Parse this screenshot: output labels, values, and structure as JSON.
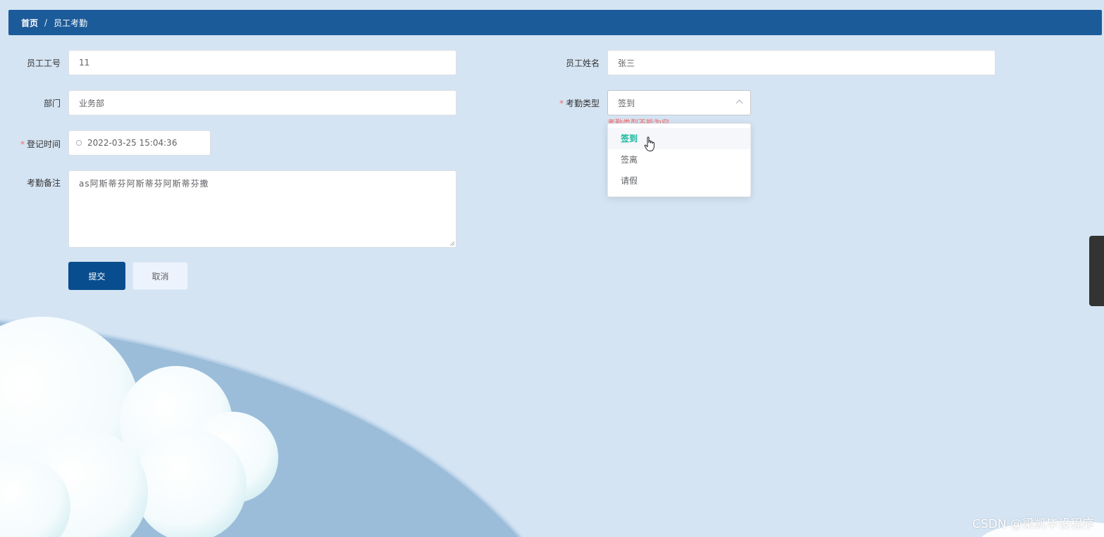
{
  "breadcrumb": {
    "home": "首页",
    "separator": "/",
    "current": "员工考勤"
  },
  "form": {
    "employee_id": {
      "label": "员工工号",
      "value": "11"
    },
    "employee_name": {
      "label": "员工姓名",
      "value": "张三"
    },
    "department": {
      "label": "部门",
      "value": "业务部"
    },
    "attendance_type": {
      "label": "考勤类型",
      "required_mark": "*",
      "value": "签到",
      "error": "考勤类型不能为空",
      "options": [
        "签到",
        "签离",
        "请假"
      ],
      "selected_option": "签到"
    },
    "register_time": {
      "label": "登记时间",
      "required_mark": "*",
      "value": "2022-03-25 15:04:36"
    },
    "remark": {
      "label": "考勤备注",
      "value": "as阿斯蒂芬阿斯蒂芬阿斯蒂芬撒"
    }
  },
  "buttons": {
    "submit": "提交",
    "cancel": "取消"
  },
  "watermark": "CSDN @梁凯毕设程序",
  "colors": {
    "header": "#1c5b9a",
    "primary_button": "#084d8e",
    "selected_option": "#15b69b",
    "error": "#f56c6c",
    "background": "#d5e4f3"
  }
}
